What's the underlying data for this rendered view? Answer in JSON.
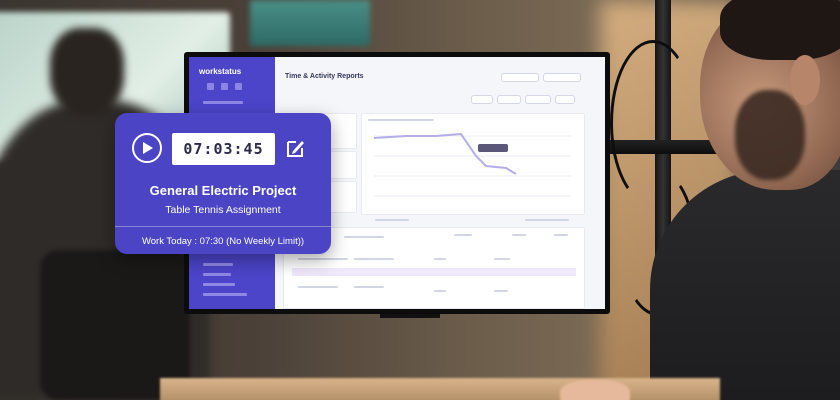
{
  "widget": {
    "timer": "07:03:45",
    "project": "General Electric Project",
    "task": "Table Tennis Assignment",
    "work_today": "Work Today : 07:30 (No Weekly Limit))",
    "icons": {
      "play": "play-icon",
      "edit": "edit-icon"
    },
    "accent_color": "#4b44c5"
  },
  "app": {
    "logo": "workstatus",
    "title": "Time & Activity Reports",
    "sidebar_color": "#4c44c9"
  }
}
